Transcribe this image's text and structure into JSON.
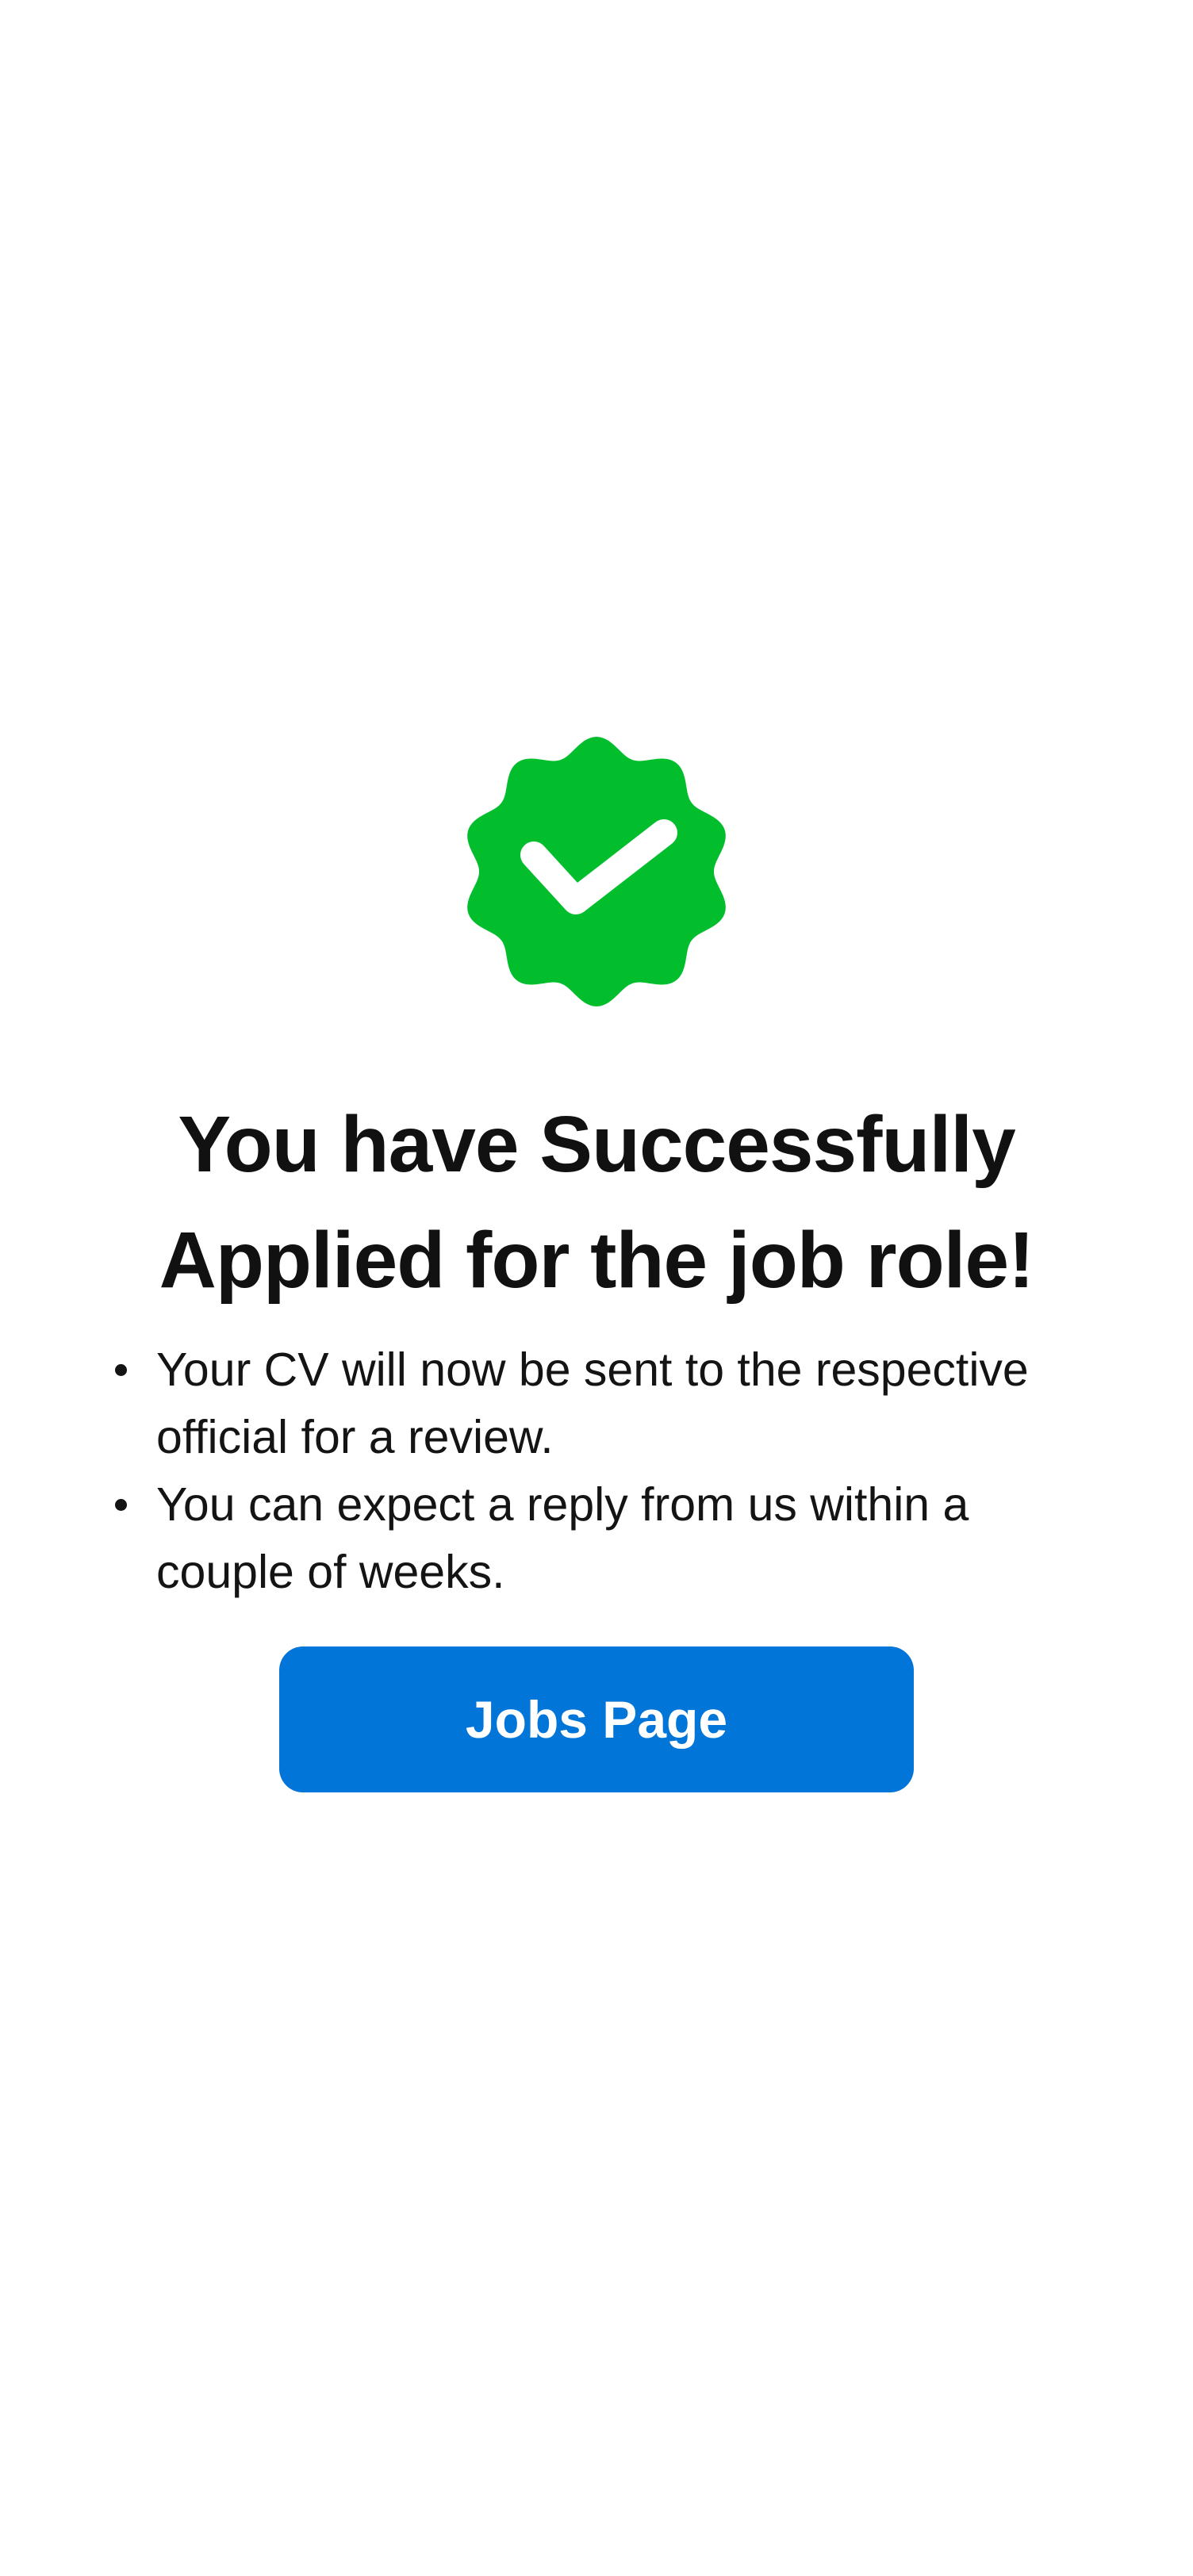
{
  "success": {
    "icon": "verified-badge-check-icon",
    "badge_color": "#02BE2C",
    "title_line1": "You have Successfully",
    "title_line2": "Applied for the job role!",
    "bullets": [
      "Your CV will now be sent to the respective official for a review.",
      "You can expect a reply from us within a couple of weeks."
    ],
    "button_label": "Jobs Page",
    "button_color": "#0275D8"
  }
}
